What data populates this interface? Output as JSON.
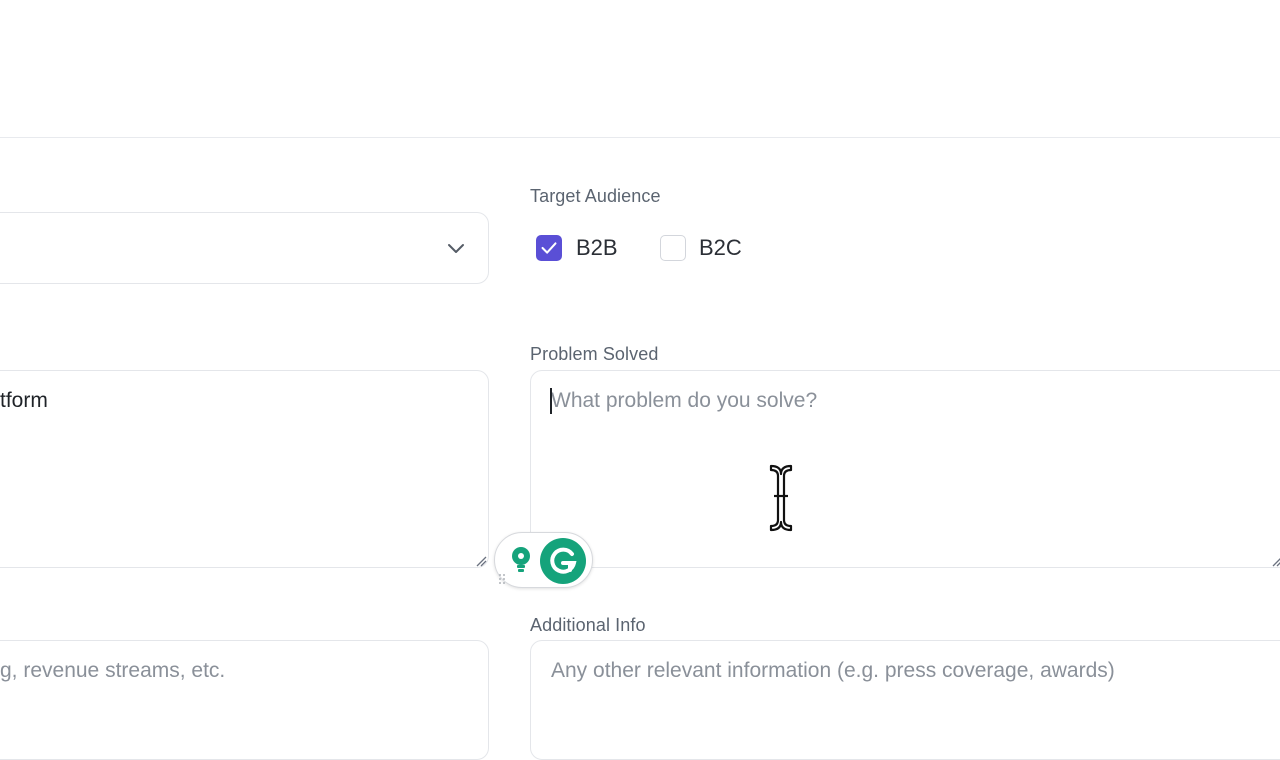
{
  "target_audience": {
    "label": "Target Audience",
    "options": [
      {
        "label": "B2B",
        "checked": true
      },
      {
        "label": "B2C",
        "checked": false
      }
    ]
  },
  "problem_solved": {
    "label": "Problem Solved",
    "placeholder": "What problem do you solve?",
    "value": ""
  },
  "left_textarea": {
    "value_fragment": "tform"
  },
  "additional_info": {
    "label": "Additional Info",
    "placeholder": "Any other relevant information (e.g. press coverage, awards)"
  },
  "left_bottom_field": {
    "placeholder_fragment": "g, revenue streams, etc."
  },
  "colors": {
    "accent": "#5a4fd6",
    "grammarly": "#15a37b"
  },
  "icons": {
    "dropdown": "chevron-down-icon",
    "checkbox_checked": "check-icon",
    "grammarly_suggestion": "lightbulb-icon",
    "grammarly_logo": "grammarly-g-icon",
    "cursor": "text-cursor-ibeam-icon"
  }
}
